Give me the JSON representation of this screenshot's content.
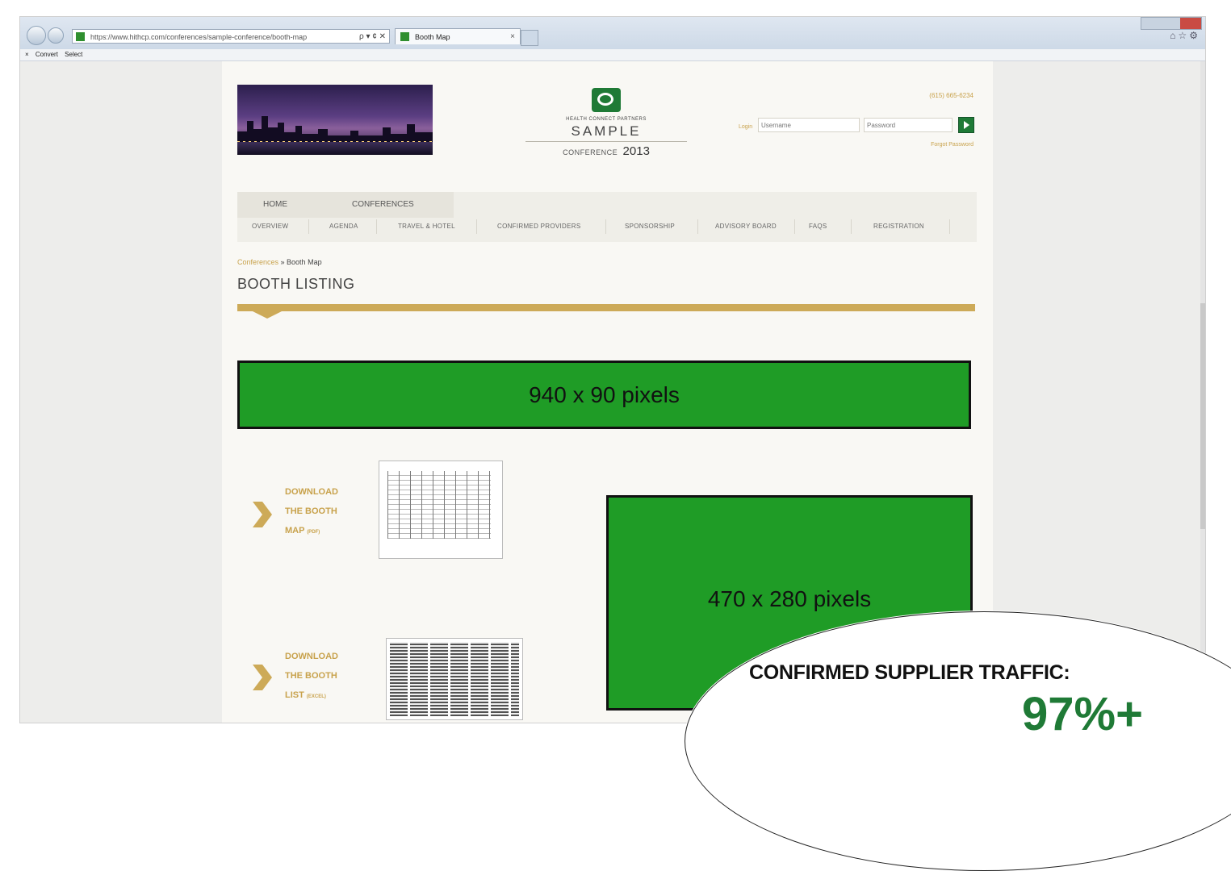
{
  "browser": {
    "url": "https://www.hithcp.com/conferences/sample-conference/booth-map",
    "address_tools": "ρ ▾ ¢ ✕",
    "tab_title": "Booth Map",
    "tab_close": "×",
    "toolbar_convert": "Convert",
    "toolbar_select": "Select"
  },
  "header": {
    "phone": "(615) 665-6234",
    "company_small": "HEALTH CONNECT PARTNERS",
    "logo_sample": "SAMPLE",
    "logo_conference": "CONFERENCE",
    "logo_year": "2013",
    "login_label": "Login",
    "username_placeholder": "Username",
    "password_placeholder": "Password",
    "forgot_password": "Forgot Password"
  },
  "nav": {
    "top": [
      "HOME",
      "CONFERENCES"
    ],
    "sub": [
      "OVERVIEW",
      "AGENDA",
      "TRAVEL & HOTEL",
      "CONFIRMED PROVIDERS",
      "SPONSORSHIP",
      "ADVISORY BOARD",
      "FAQS",
      "REGISTRATION"
    ]
  },
  "breadcrumb": {
    "link": "Conferences",
    "separator": " » ",
    "current": "Booth Map"
  },
  "page_title": "BOOTH LISTING",
  "ads": {
    "banner_label": "940 x 90 pixels",
    "box_label": "470 x 280 pixels"
  },
  "downloads": {
    "map": {
      "line1": "DOWNLOAD",
      "line2": "THE BOOTH",
      "line3": "MAP",
      "format": "(PDF)"
    },
    "list": {
      "line1": "DOWNLOAD",
      "line2": "THE BOOTH",
      "line3": "LIST",
      "format": "(EXCEL)"
    }
  },
  "callout": {
    "title": "CONFIRMED SUPPLIER TRAFFIC:",
    "stat": "97%+"
  },
  "colors": {
    "gold": "#cdaa58",
    "brand_green": "#1f7a36",
    "ad_green": "#1f9c26"
  }
}
